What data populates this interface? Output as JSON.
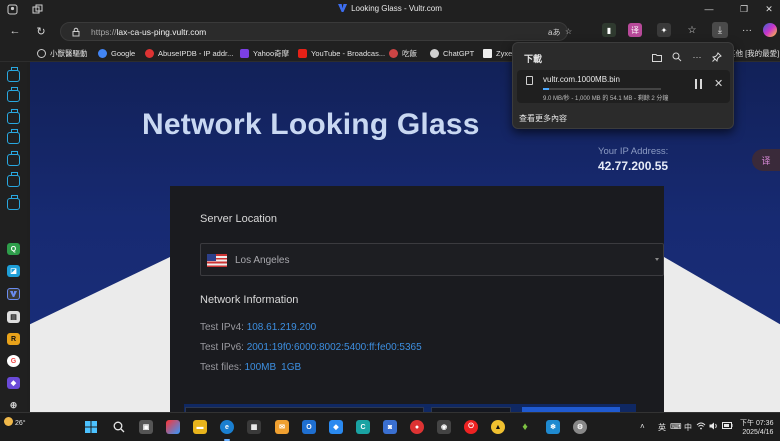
{
  "window": {
    "title": "Looking Glass - Vultr.com"
  },
  "address_bar": {
    "url_prefix": "https://",
    "url_host": "lax-ca-us-ping.vultr.com",
    "read_aloud_label": "aあ"
  },
  "bookmarks": [
    {
      "label": "小獸醫驅動",
      "color": "#f0b429"
    },
    {
      "label": "Google",
      "color": "#4285f4"
    },
    {
      "label": "AbuseIPDB - IP addr...",
      "color": "#d33"
    },
    {
      "label": "Yahoo奇摩",
      "color": "#7b3fe4"
    },
    {
      "label": "YouTube - Broadcas...",
      "color": "#e62117"
    },
    {
      "label": "吃飯",
      "color": "#c44"
    },
    {
      "label": "ChatGPT",
      "color": "#cfcfcf"
    },
    {
      "label": "Zyxe",
      "color": "#cfcfcf"
    },
    {
      "label": "其他 [我的最愛]",
      "color": "#f0b429"
    }
  ],
  "page": {
    "hero_title": "Network Looking Glass",
    "ip_label": "Your IP Address:",
    "ip_value": "42.77.200.55",
    "server_location_heading": "Server Location",
    "selected_location": "Los Angeles",
    "network_info_heading": "Network Information",
    "ipv4_label": "Test IPv4:",
    "ipv4_value": "108.61.219.200",
    "ipv6_label": "Test IPv6:",
    "ipv6_value": "2001:19f0:6000:8002:5400:ff:fe00:5365",
    "files_label": "Test files:",
    "file_100mb": "100MB",
    "file_1gb": "1GB"
  },
  "downloads": {
    "title": "下載",
    "file_name": "vultr.com.1000MB.bin",
    "status": "9.0 MB/秒 - 1,000 MB 的 54.1 MB - 剩餘 2 分鐘",
    "progress_fraction": 0.054,
    "see_more": "查看更多內容"
  },
  "taskbar": {
    "weather_temp": "26°",
    "time": "下午 07:36",
    "date": "2025/4/16",
    "ime_label": "英",
    "tray_lang": "中"
  },
  "colors": {
    "accent": "#3d8fe0",
    "hero_bg": "#172a72",
    "card_bg": "#1a1b1f"
  }
}
